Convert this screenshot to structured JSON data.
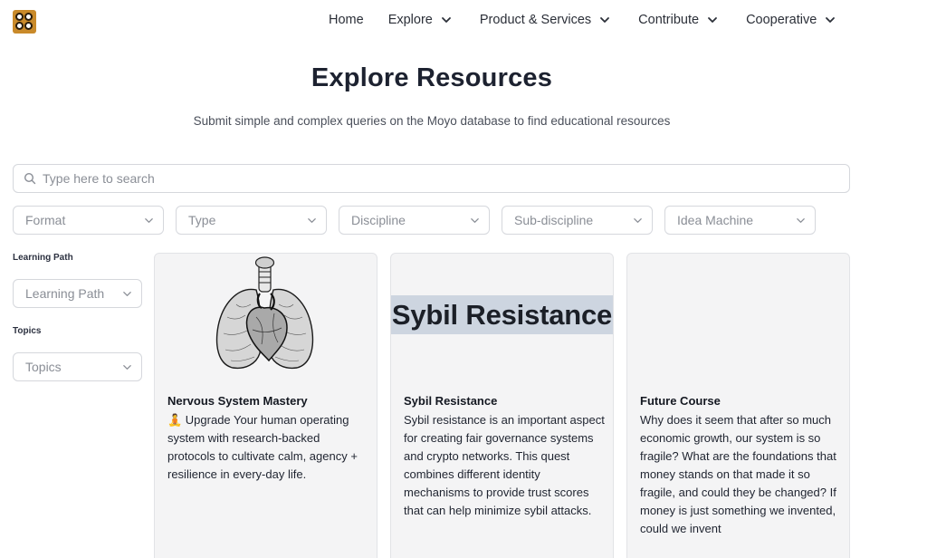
{
  "nav": {
    "home": "Home",
    "explore": "Explore",
    "products": "Product & Services",
    "contribute": "Contribute",
    "cooperative": "Cooperative"
  },
  "page": {
    "title": "Explore Resources",
    "subtitle": "Submit simple and complex queries on the Moyo database to find educational resources"
  },
  "search": {
    "placeholder": "Type here to search"
  },
  "filters": [
    "Format",
    "Type",
    "Discipline",
    "Sub-discipline",
    "Idea Machine"
  ],
  "sidebar": {
    "learning_path_label": "Learning Path",
    "learning_path_select": "Learning Path",
    "topics_label": "Topics",
    "topics_select": "Topics"
  },
  "cards": [
    {
      "title": "Nervous System Mastery",
      "description": "🧘 Upgrade Your human operating system with research-backed protocols to cultivate calm, agency + resilience in every-day life.",
      "image": "heart-lungs-illustration"
    },
    {
      "title": "Sybil Resistance",
      "banner": "Sybil Resistance",
      "description": "Sybil resistance is an important aspect for creating fair governance systems and crypto networks. This quest combines different identity mechanisms to provide trust scores that can help minimize sybil attacks."
    },
    {
      "title": "Future Course",
      "description": "Why does it seem that after so much economic growth, our system is so fragile? What are the foundations that money stands on that made it so fragile, and could they be changed? If money is just something we invented, could we invent"
    }
  ],
  "colors": {
    "logo": "#c98a2a",
    "card_bg": "#f4f4f5",
    "banner_bg": "#cdd5e0"
  }
}
